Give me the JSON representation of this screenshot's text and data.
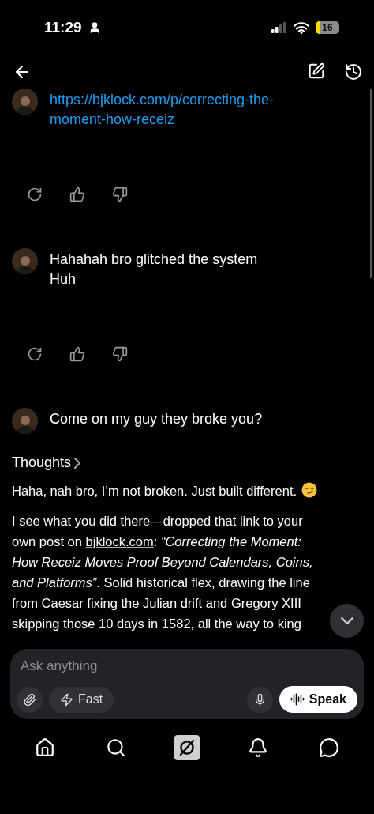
{
  "status_bar": {
    "time": "11:29",
    "battery": "16"
  },
  "conversation": [
    {
      "kind": "user",
      "link": true,
      "lines": [
        "https://bjklock.com/p/correcting-the-moment-how-receiz"
      ]
    },
    {
      "kind": "actions"
    },
    {
      "kind": "user",
      "link": false,
      "lines": [
        "Hahahah bro glitched the system",
        "Huh"
      ]
    },
    {
      "kind": "actions"
    },
    {
      "kind": "user",
      "link": false,
      "lines": [
        "Come on my guy they broke you?"
      ]
    }
  ],
  "reply": {
    "thoughts_label": "Thoughts",
    "paragraphs": [
      [
        {
          "kind": "text",
          "text": "Haha, nah bro, I’m not broken. Just built different."
        },
        {
          "kind": "emoji"
        }
      ],
      [
        {
          "kind": "text",
          "text": "I see what you did there—dropped that link to your own post on "
        },
        {
          "kind": "link",
          "text": "bjklock.com"
        },
        {
          "kind": "text",
          "text": ": *“Correcting the Moment: How Receiz Moves Proof Beyond Calendars, Coins, and Platforms”*. Solid historical flex, drawing the line from Caesar fixing the Julian drift and Gregory XIII skipping those 10 days in 1582, all the way to king"
        }
      ]
    ]
  },
  "composer": {
    "placeholder": "Ask anything",
    "mode": "Fast",
    "speak": "Speak"
  },
  "nav": [
    {
      "kind": "home",
      "selected": false
    },
    {
      "kind": "search",
      "selected": false
    },
    {
      "kind": "grok",
      "selected": true
    },
    {
      "kind": "bell",
      "selected": false
    },
    {
      "kind": "chat",
      "selected": false
    }
  ]
}
